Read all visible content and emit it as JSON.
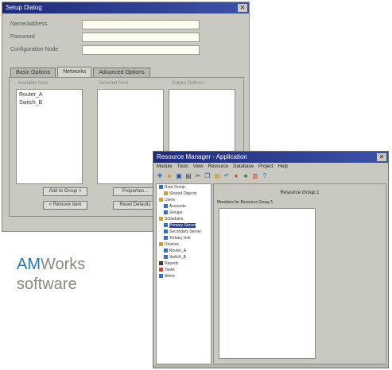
{
  "dialog": {
    "title": "Setup Dialog",
    "close_glyph": "✕",
    "fields": [
      {
        "label": "Name/Address",
        "value": ""
      },
      {
        "label": "Password",
        "value": ""
      },
      {
        "label": "Configuration Node",
        "value": ""
      }
    ],
    "tabs": [
      "Basic Options",
      "Networks",
      "Advanced Options"
    ],
    "active_tab": 1,
    "columns": [
      "Available Nets",
      "Selected Nets",
      "Output Options"
    ],
    "list_items": [
      "Router_A",
      "Switch_B"
    ],
    "buttons": [
      "Add to Group >",
      "< Remove Item",
      "Properties...",
      "Reset Defaults"
    ]
  },
  "tagline": {
    "brand_accent": "AM",
    "brand_rest": "Works",
    "line2": "software"
  },
  "app": {
    "title": "Resource Manager - Application",
    "menu": [
      "Module",
      "Tools",
      "View",
      "Resource",
      "Database",
      "Project",
      "Help"
    ],
    "toolbar_icons": [
      "new-icon",
      "open-icon",
      "save-icon",
      "print-icon",
      "cut-icon",
      "copy-icon",
      "paste-icon",
      "undo-icon",
      "find-icon",
      "tree-icon",
      "properties-icon",
      "help-icon"
    ],
    "tree": [
      {
        "label": "Root Group",
        "color": "#3a6fc0",
        "indent": 0
      },
      {
        "label": "Shared Objects",
        "color": "#c9a03a",
        "indent": 1
      },
      {
        "label": "Users",
        "color": "#c9a03a",
        "indent": 0
      },
      {
        "label": "Accounts",
        "color": "#3a6fc0",
        "indent": 1
      },
      {
        "label": "Groups",
        "color": "#3a6fc0",
        "indent": 1
      },
      {
        "label": "Schedules",
        "color": "#c9a03a",
        "indent": 0
      },
      {
        "label": "Primary Server",
        "color": "#3a6fc0",
        "indent": 1
      },
      {
        "label": "Secondary Server",
        "color": "#3a6fc0",
        "indent": 1
      },
      {
        "label": "Tertiary Unit",
        "color": "#3a6fc0",
        "indent": 1
      },
      {
        "label": "Devices",
        "color": "#c9a03a",
        "indent": 0
      },
      {
        "label": "Router_A",
        "color": "#3a6fc0",
        "indent": 1
      },
      {
        "label": "Switch_B",
        "color": "#3a6fc0",
        "indent": 1
      },
      {
        "label": "Reports",
        "color": "#3a3a3a",
        "indent": 0
      },
      {
        "label": "Tasks",
        "color": "#c04a3a",
        "indent": 0
      },
      {
        "label": "Alerts",
        "color": "#3a6fc0",
        "indent": 0
      }
    ],
    "selected_tree_index": 6,
    "pane_title": "Resource Group 1",
    "pane_subtitle": "Members for Resource Group 1"
  },
  "colors": {
    "titlebar": "#1f2a7a",
    "accent": "#2a77b5",
    "selection": "#2b3f8c"
  }
}
